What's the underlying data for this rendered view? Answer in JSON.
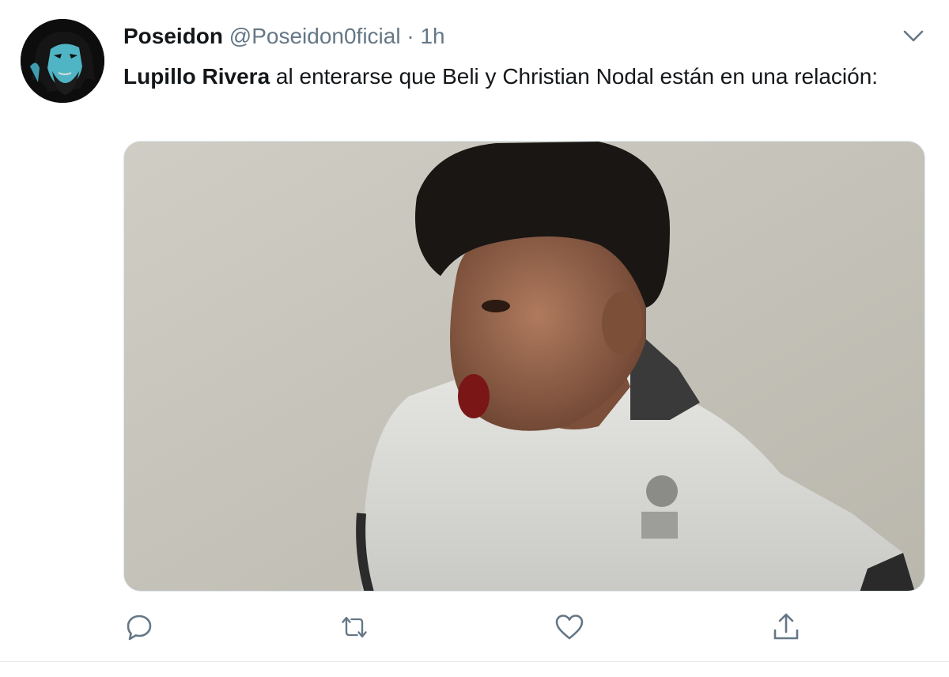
{
  "tweet": {
    "display_name": "Poseidon",
    "handle": "@Poseidon0ficial",
    "separator": "·",
    "time": "1h",
    "mention": "Lupillo Rivera",
    "text": " al enterarse que Beli y Christian Nodal están en una relación:",
    "avatar_icon": "avatar-icon",
    "media_icon": "photo"
  },
  "actions": {
    "reply_icon": "reply-icon",
    "retweet_icon": "retweet-icon",
    "like_icon": "heart-icon",
    "share_icon": "share-icon"
  },
  "colors": {
    "text": "#14171a",
    "secondary": "#657786",
    "icon": "#657786",
    "divider": "#e6ecf0"
  }
}
